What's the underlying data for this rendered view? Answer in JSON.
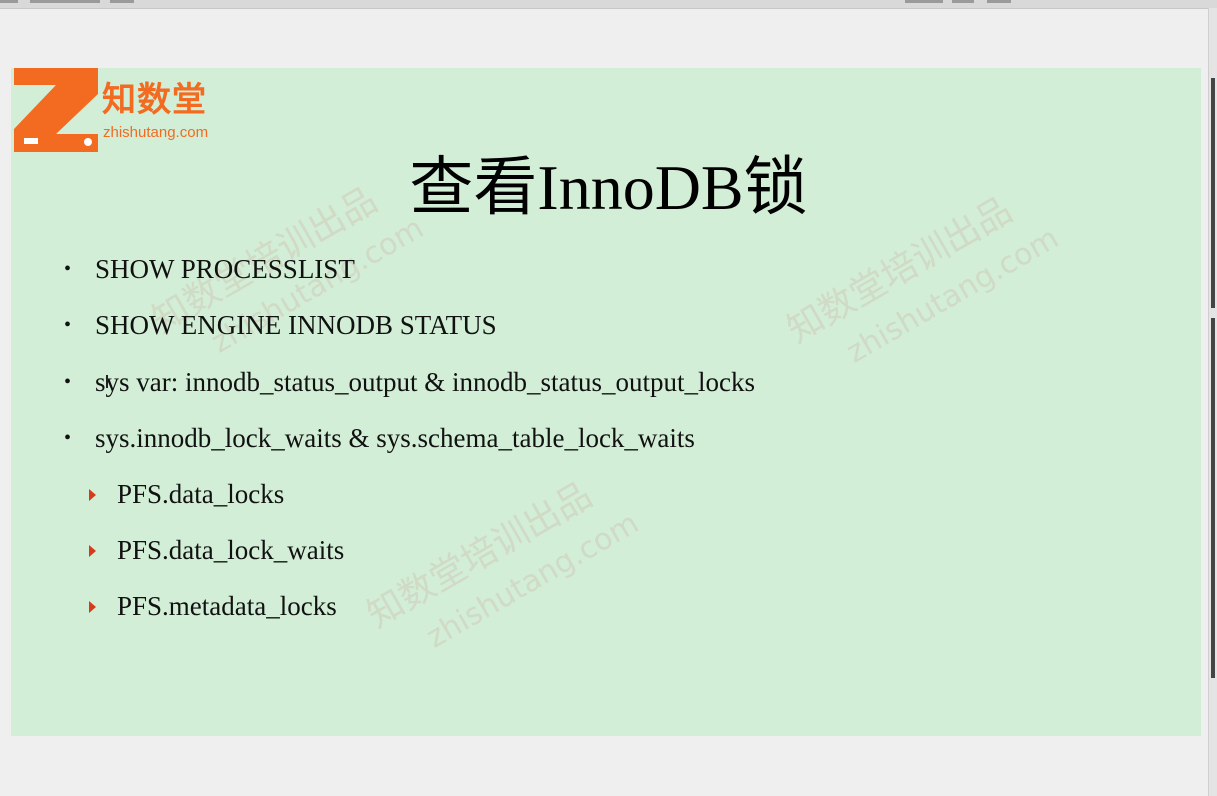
{
  "logo": {
    "name_cn": "知数堂",
    "url": "zhishutang.com",
    "brand_color": "#f26b21"
  },
  "slide": {
    "title": "查看InnoDB锁",
    "background": "#d2eed6",
    "bullets": [
      "SHOW PROCESSLIST",
      "SHOW ENGINE INNODB STATUS",
      "sys var: innodb_status_output & innodb_status_output_locks",
      "sys.innodb_lock_waits & sys.schema_table_lock_waits"
    ],
    "sub_bullets": [
      "PFS.data_locks",
      "PFS.data_lock_waits",
      "PFS.metadata_locks"
    ],
    "sub_bullet_color": "#d6391b"
  },
  "watermark": {
    "text_cn": "知数堂培训出品",
    "text_url": "zhishutang.com"
  }
}
